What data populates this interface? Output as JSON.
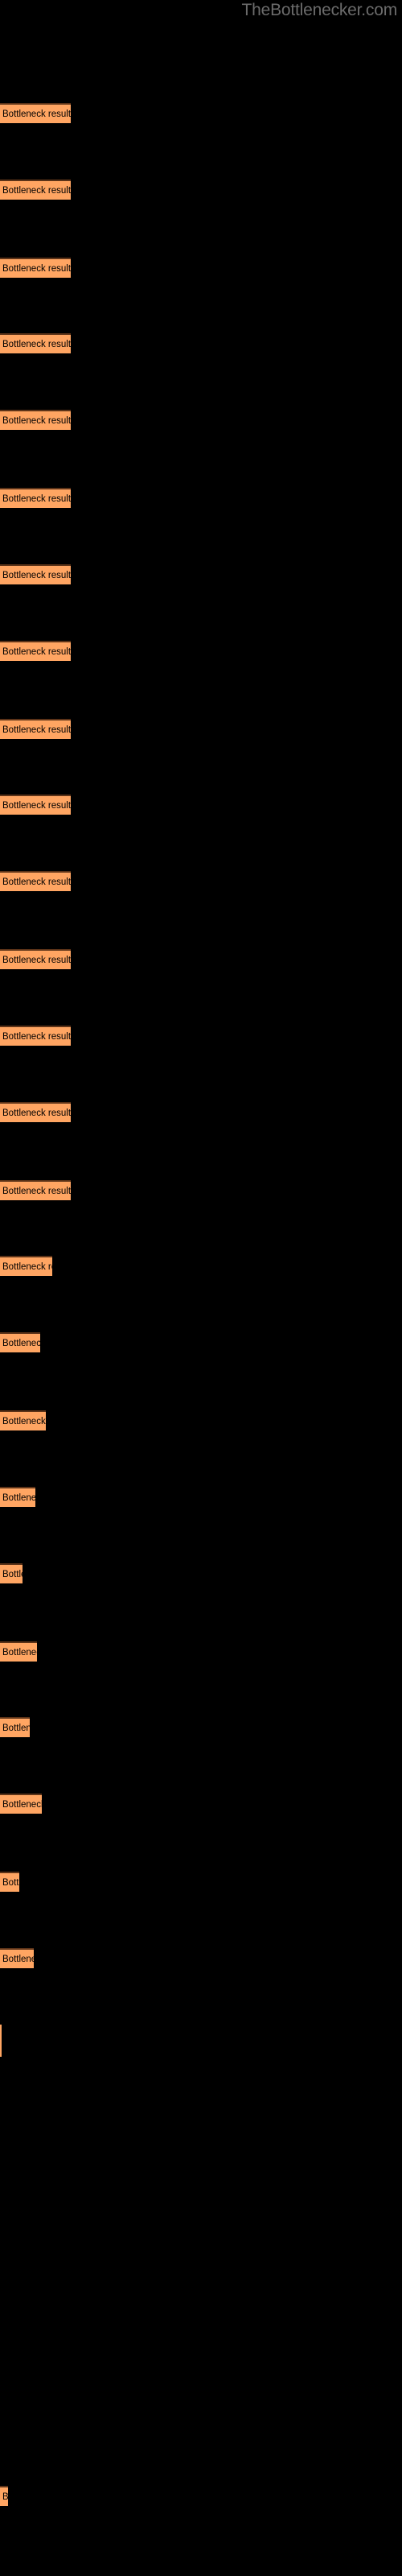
{
  "site": {
    "title": "TheBottlenecker.com",
    "title_color": "#6b6b6b",
    "background_color": "#000000"
  },
  "chart_data": {
    "type": "bar",
    "orientation": "horizontal",
    "title": "",
    "subtitle": "",
    "xlabel": "",
    "ylabel": "",
    "grid": false,
    "legend": null,
    "bar_color": "#ffa562",
    "bar_border_color": "#5c3318",
    "label_color": "#000000",
    "categories": [
      "Bottleneck result",
      "Bottleneck result",
      "Bottleneck result",
      "Bottleneck result",
      "Bottleneck result",
      "Bottleneck result",
      "Bottleneck result",
      "Bottleneck result",
      "Bottleneck result",
      "Bottleneck result",
      "Bottleneck result",
      "Bottleneck result",
      "Bottleneck result",
      "Bottleneck result",
      "Bottleneck result",
      "Bottleneck result",
      "Bottleneck result",
      "Bottleneck result",
      "Bottleneck result",
      "Bottleneck result",
      "Bottleneck result",
      "Bottleneck result",
      "Bottleneck result",
      "Bottleneck result",
      "Bottleneck result",
      "Bottleneck result",
      "Bottleneck result",
      "Bottleneck result"
    ],
    "values": [
      88,
      88,
      88,
      88,
      88,
      88,
      88,
      88,
      88,
      88,
      88,
      88,
      88,
      88,
      88,
      65,
      50,
      57,
      44,
      28,
      46,
      37,
      52,
      24,
      42,
      2,
      0,
      10
    ],
    "xlim": [
      0,
      500
    ],
    "bar_label_text": "Bottleneck result",
    "bars": [
      {
        "label": "Bottleneck result",
        "width": 88,
        "top": 58,
        "sliver": false
      },
      {
        "label": "Bottleneck result",
        "width": 88,
        "top": 101,
        "sliver": false
      },
      {
        "label": "Bottleneck result",
        "width": 88,
        "top": 145,
        "sliver": false
      },
      {
        "label": "Bottleneck result",
        "width": 88,
        "top": 188,
        "sliver": false
      },
      {
        "label": "Bottleneck result",
        "width": 88,
        "top": 231,
        "sliver": false
      },
      {
        "label": "Bottleneck result",
        "width": 88,
        "top": 275,
        "sliver": false
      },
      {
        "label": "Bottleneck result",
        "width": 88,
        "top": 318,
        "sliver": false
      },
      {
        "label": "Bottleneck result",
        "width": 88,
        "top": 361,
        "sliver": false
      },
      {
        "label": "Bottleneck result",
        "width": 88,
        "top": 405,
        "sliver": false
      },
      {
        "label": "Bottleneck result",
        "width": 88,
        "top": 448,
        "sliver": false
      },
      {
        "label": "Bottleneck result",
        "width": 88,
        "top": 491,
        "sliver": false
      },
      {
        "label": "Bottleneck result",
        "width": 88,
        "top": 535,
        "sliver": false
      },
      {
        "label": "Bottleneck result",
        "width": 88,
        "top": 578,
        "sliver": false
      },
      {
        "label": "Bottleneck result",
        "width": 88,
        "top": 621,
        "sliver": false
      },
      {
        "label": "Bottleneck result",
        "width": 88,
        "top": 665,
        "sliver": false
      },
      {
        "label": "Bottleneck result",
        "width": 65,
        "top": 708,
        "sliver": false
      },
      {
        "label": "Bottleneck result",
        "width": 50,
        "top": 751,
        "sliver": false
      },
      {
        "label": "Bottleneck result",
        "width": 57,
        "top": 795,
        "sliver": false
      },
      {
        "label": "Bottleneck result",
        "width": 44,
        "top": 838,
        "sliver": false
      },
      {
        "label": "Bottleneck result",
        "width": 28,
        "top": 881,
        "sliver": false
      },
      {
        "label": "Bottleneck result",
        "width": 46,
        "top": 925,
        "sliver": false
      },
      {
        "label": "Bottleneck result",
        "width": 37,
        "top": 968,
        "sliver": false
      },
      {
        "label": "Bottleneck result",
        "width": 52,
        "top": 1011,
        "sliver": false
      },
      {
        "label": "Bottleneck result",
        "width": 24,
        "top": 1055,
        "sliver": false
      },
      {
        "label": "Bottleneck result",
        "width": 42,
        "top": 1098,
        "sliver": false
      },
      {
        "label": "Bottleneck result",
        "width": 2,
        "top": 1141,
        "sliver": true
      },
      {
        "label": "Bottleneck result",
        "width": 10,
        "top": 1401,
        "sliver": false
      }
    ]
  }
}
